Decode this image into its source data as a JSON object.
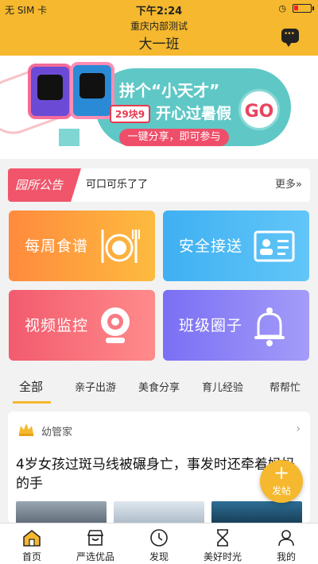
{
  "status_bar": {
    "carrier": "无 SIM 卡",
    "time": "下午2:24"
  },
  "header": {
    "subtitle": "重庆内部测试",
    "class_name": "大一班",
    "chat_icon": "chat-bubble-icon"
  },
  "banner": {
    "headline_prefix": "拼个",
    "headline_quote": "“小天才”",
    "price_tag": "29块9",
    "headline_suffix": "开心过暑假",
    "share_text": "一键分享，即可参与",
    "go_label": "GO",
    "colors": {
      "teal": "#5fc8c6",
      "pink": "#ee4e69"
    }
  },
  "notice": {
    "tag": "园所公告",
    "text": "可口可乐了了",
    "more": "更多"
  },
  "tiles": [
    {
      "label": "每周食谱",
      "icon": "plate-fork-knife-icon",
      "color": "#ff8a3d"
    },
    {
      "label": "安全接送",
      "icon": "id-card-icon",
      "color": "#3fb0f2"
    },
    {
      "label": "视频监控",
      "icon": "webcam-icon",
      "color": "#f25b6e"
    },
    {
      "label": "班级圈子",
      "icon": "bell-icon",
      "color": "#7a6ff4"
    }
  ],
  "categories": {
    "active_index": 0,
    "items": [
      "全部",
      "亲子出游",
      "美食分享",
      "育儿经验",
      "帮帮忙"
    ]
  },
  "feed": {
    "author": "幼管家",
    "title": "4岁女孩过斑马线被碾身亡，事发时还牵着妈妈的手"
  },
  "fab": {
    "icon": "plus-icon",
    "label": "发帖"
  },
  "bottom_nav": {
    "active_index": 0,
    "items": [
      {
        "label": "首页",
        "icon": "home-icon"
      },
      {
        "label": "严选优品",
        "icon": "shop-icon"
      },
      {
        "label": "发现",
        "icon": "compass-icon"
      },
      {
        "label": "美好时光",
        "icon": "hourglass-icon"
      },
      {
        "label": "我的",
        "icon": "user-icon"
      }
    ]
  }
}
